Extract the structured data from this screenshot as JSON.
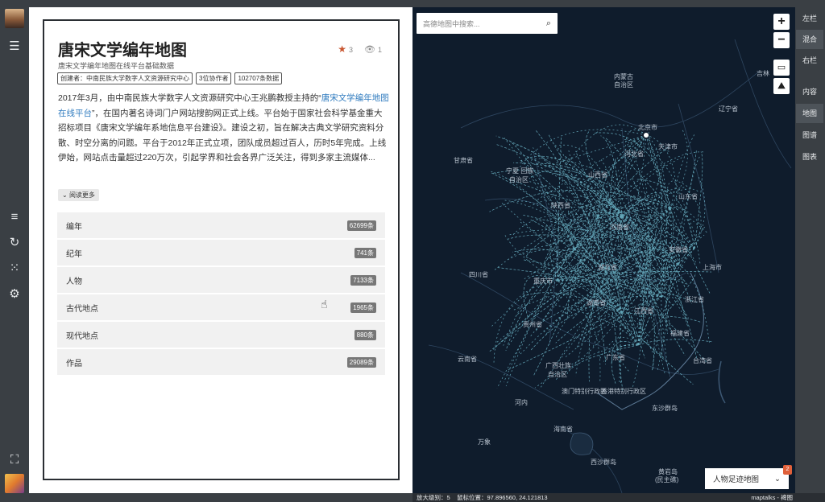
{
  "left_rail": {
    "icons": [
      "menu-icon",
      "list-icon",
      "history-icon",
      "grid-icon",
      "settings-icon",
      "fullscreen-icon"
    ]
  },
  "panel": {
    "title": "唐宋文学编年地图",
    "favorites": "3",
    "views": "1",
    "subtitle": "唐宋文学编年地图在线平台基础数据",
    "tags": [
      "创建者：中南民族大学数字人文资源研究中心",
      "3位协作者",
      "102707条数据"
    ],
    "desc_part1": "2017年3月，由中南民族大学数字人文资源研究中心王兆鹏教授主持的“",
    "desc_link": "唐宋文学编年地图在线平台",
    "desc_part2": "”，在国内著名诗词门户网站搜韵网正式上线。平台始于国家社会科学基金重大招标项目《唐宋文学编年系地信息平台建设》。建设之初，旨在解决古典文学研究资料分散、时空分离的问题。平台于2012年正式立项，团队成员超过百人，历时5年完成。上线伊始，网站点击量超过220万次，引起学界和社会各界广泛关注，得到多家主流媒体...",
    "read_more": "阅读更多",
    "rows": [
      {
        "label": "编年",
        "count": "62699条"
      },
      {
        "label": "纪年",
        "count": "741条"
      },
      {
        "label": "人物",
        "count": "7133条"
      },
      {
        "label": "古代地点",
        "count": "1965条"
      },
      {
        "label": "现代地点",
        "count": "880条"
      },
      {
        "label": "作品",
        "count": "29089条"
      }
    ]
  },
  "map": {
    "search_placeholder": "高德地图中搜索...",
    "zoom_in": "+",
    "zoom_out": "−",
    "labels": [
      {
        "text": "内蒙古",
        "id": "label-neimenggu"
      },
      {
        "text": "自治区",
        "id": "label-zizhiqu"
      },
      {
        "text": "吉林",
        "id": "label-jilin"
      },
      {
        "text": "辽宁省",
        "id": "label-liaoning"
      },
      {
        "text": "北京市",
        "id": "label-beijing"
      },
      {
        "text": "河北省",
        "id": "label-hebei"
      },
      {
        "text": "甘肃省",
        "id": "label-gansu"
      },
      {
        "text": "宁夏 回族",
        "id": "label-ningxia"
      },
      {
        "text": "自治区",
        "id": "label-ningxia2"
      },
      {
        "text": "山西省",
        "id": "label-shanxi"
      },
      {
        "text": "陕西省",
        "id": "label-shaanxi"
      },
      {
        "text": "四川省",
        "id": "label-sichuan"
      },
      {
        "text": "贵州省",
        "id": "label-guizhou"
      },
      {
        "text": "云南省",
        "id": "label-yunnan"
      },
      {
        "text": "广西壮族",
        "id": "label-guangxi"
      },
      {
        "text": "自治区",
        "id": "label-guangxi2"
      },
      {
        "text": "澳门特别行政区",
        "id": "label-macau"
      },
      {
        "text": "香港特别行政区",
        "id": "label-hongkong"
      },
      {
        "text": "台湾省",
        "id": "label-taiwan"
      },
      {
        "text": "东沙群岛",
        "id": "label-dongsha"
      },
      {
        "text": "海南省",
        "id": "label-hainan"
      },
      {
        "text": "河内",
        "id": "label-hanoi"
      },
      {
        "text": "万象",
        "id": "label-vientiane"
      },
      {
        "text": "西沙群岛",
        "id": "label-xisha"
      },
      {
        "text": "黄岩岛",
        "id": "label-huangyan"
      },
      {
        "text": "(民主礁)",
        "id": "label-minzhu"
      },
      {
        "text": "上海市",
        "id": "label-shanghai"
      },
      {
        "text": "浙江省",
        "id": "label-zhejiang"
      },
      {
        "text": "福建省",
        "id": "label-fujian"
      },
      {
        "text": "湖南省",
        "id": "label-hunan"
      },
      {
        "text": "江西省",
        "id": "label-jiangxi"
      },
      {
        "text": "广东省",
        "id": "label-guangdong"
      },
      {
        "text": "重庆市",
        "id": "label-chongqing"
      },
      {
        "text": "湖北省",
        "id": "label-hubei"
      },
      {
        "text": "河南省",
        "id": "label-henan"
      },
      {
        "text": "安徽省",
        "id": "label-anhui"
      },
      {
        "text": "山东省",
        "id": "label-shandong"
      },
      {
        "text": "天津市",
        "id": "label-tianjin"
      }
    ],
    "layer_label": "人物足迹地图",
    "layer_count": "2"
  },
  "right_tabs": [
    "左栏",
    "混合",
    "右栏",
    "内容",
    "地图",
    "图谱",
    "图表"
  ],
  "status": {
    "zoom_text": "放大级别：5",
    "mouse_text": "鼠标位置：97.896560, 24.121813",
    "attribution": "maptalks - 裨图"
  },
  "colors": {
    "accent": "#c8542e",
    "link": "#2f7bbf",
    "map_bg": "#0f1c2c",
    "route": "#7fd3e6"
  }
}
